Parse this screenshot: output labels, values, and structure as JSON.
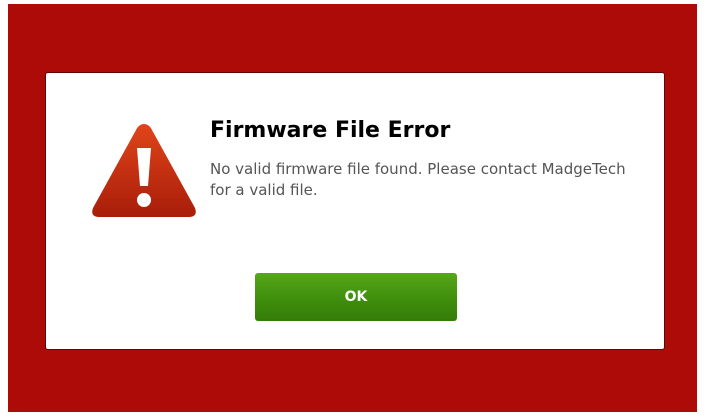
{
  "colors": {
    "background": "#ac0b08",
    "dialog_background": "#ffffff",
    "icon_red": "#c42d10",
    "button_green": "#3d8c0b"
  },
  "dialog": {
    "icon": "warning-triangle-icon",
    "title": "Firmware File Error",
    "message": "No valid firmware file found. Please contact MadgeTech for a valid file.",
    "ok_label": "OK"
  }
}
